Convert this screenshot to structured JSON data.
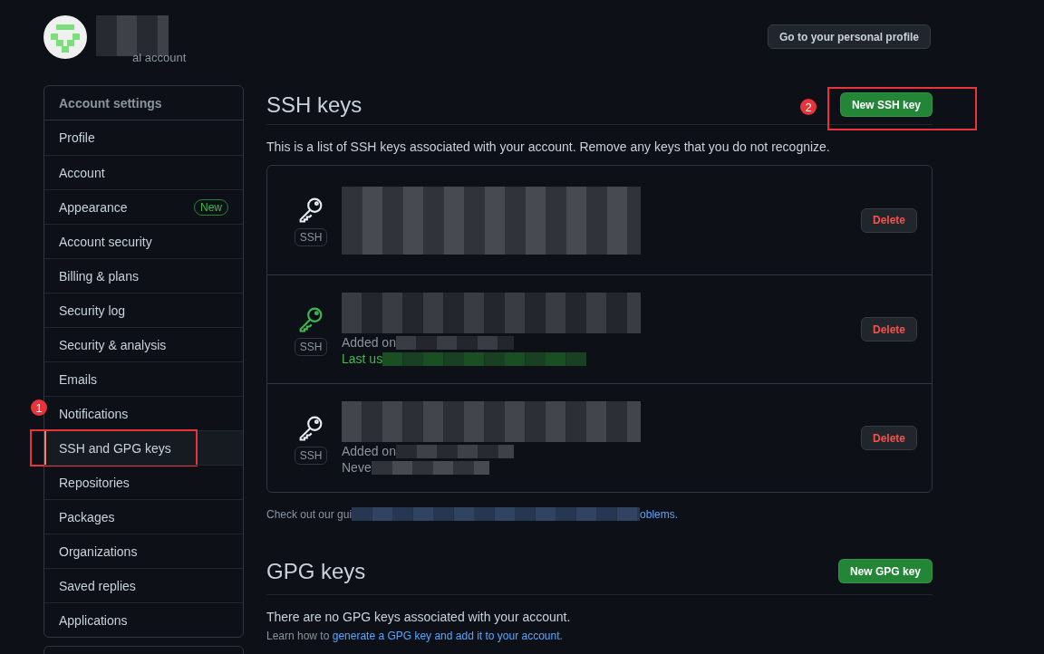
{
  "header": {
    "subtitle": "al account",
    "profile_button": "Go to your personal profile"
  },
  "sidebar": {
    "title": "Account settings",
    "items": [
      {
        "label": "Profile",
        "selected": false
      },
      {
        "label": "Account",
        "selected": false
      },
      {
        "label": "Appearance",
        "selected": false,
        "badge": "New"
      },
      {
        "label": "Account security",
        "selected": false
      },
      {
        "label": "Billing & plans",
        "selected": false
      },
      {
        "label": "Security log",
        "selected": false
      },
      {
        "label": "Security & analysis",
        "selected": false
      },
      {
        "label": "Emails",
        "selected": false
      },
      {
        "label": "Notifications",
        "selected": false
      },
      {
        "label": "SSH and GPG keys",
        "selected": true,
        "annotation": "1"
      },
      {
        "label": "Repositories",
        "selected": false
      },
      {
        "label": "Packages",
        "selected": false
      },
      {
        "label": "Organizations",
        "selected": false
      },
      {
        "label": "Saved replies",
        "selected": false
      },
      {
        "label": "Applications",
        "selected": false
      }
    ]
  },
  "ssh": {
    "title": "SSH keys",
    "new_button": "New SSH key",
    "annotation": "2",
    "description": "This is a list of SSH keys associated with your account. Remove any keys that you do not recognize.",
    "keys": [
      {
        "type": "SSH",
        "recent": false,
        "delete": "Delete"
      },
      {
        "type": "SSH",
        "recent": true,
        "delete": "Delete",
        "lines": [
          {
            "text": "Added on",
            "kind": "muted"
          },
          {
            "text": "Last us",
            "kind": "used"
          }
        ]
      },
      {
        "type": "SSH",
        "recent": false,
        "delete": "Delete",
        "lines": [
          {
            "text": "Added on",
            "kind": "muted"
          },
          {
            "text": "Neve",
            "kind": "muted"
          }
        ]
      }
    ],
    "guide_start": "Check out our gui",
    "guide_link": "oblems."
  },
  "gpg": {
    "title": "GPG keys",
    "new_button": "New GPG key",
    "empty": "There are no GPG keys associated with your account.",
    "learn_start": "Learn how to ",
    "learn_link": "generate a GPG key and add it to your account",
    "learn_end": "."
  }
}
